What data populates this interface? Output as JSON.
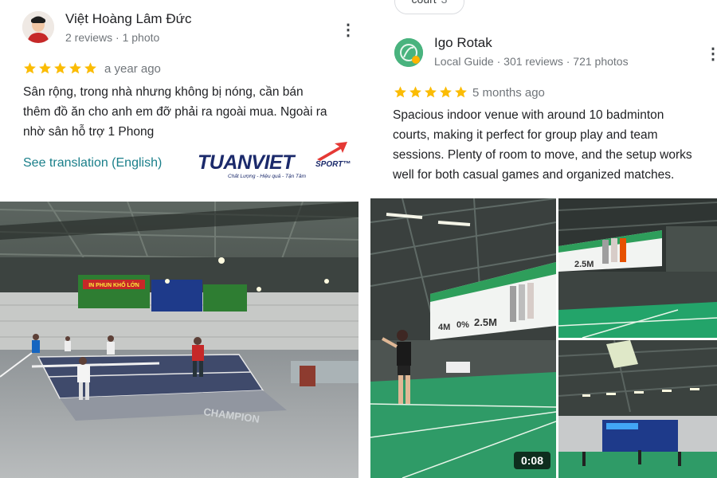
{
  "left_review": {
    "author": "Việt Hoàng Lâm Đức",
    "meta": "2 reviews · 1 photo",
    "rating": 5,
    "date": "a year ago",
    "text_lines": [
      "Sân rộng, trong nhà nhưng không bị nóng, cần bán",
      "thêm đồ ăn cho anh em đỡ phải ra ngoài mua. Ngoài ra",
      "nhờ sân hỗ trợ 1 Phong"
    ],
    "translate_label": "See translation (English)",
    "logo": {
      "main": "TUANVIET",
      "sport": "SPORT",
      "tm": "™",
      "slogan": "Chất Lượng - Hiệu quả - Tận Tâm"
    },
    "photo": {
      "floor_text": "CHAMPION",
      "banner_text": "IN PHUN KHỔ LỚN"
    }
  },
  "right_review": {
    "chip": {
      "label": "court",
      "count": "3"
    },
    "author": "Igo Rotak",
    "meta": "Local Guide · 301 reviews · 721 photos",
    "rating": 5,
    "date": "5 months ago",
    "text_lines": [
      "Spacious indoor venue with around 10 badminton",
      "courts, making it perfect for group play and team",
      "sessions. Plenty of room to move, and the setup works",
      "well for both casual games and organized matches."
    ],
    "video_duration": "0:08",
    "banner_values": [
      "4M",
      "0%",
      "2.5M"
    ]
  },
  "colors": {
    "star": "#fbbc04",
    "link": "#1a7f8a",
    "logo_blue": "#1b2a6b",
    "logo_red": "#e53935"
  },
  "icons": {
    "more": "more-vert-icon",
    "star": "star-icon"
  }
}
